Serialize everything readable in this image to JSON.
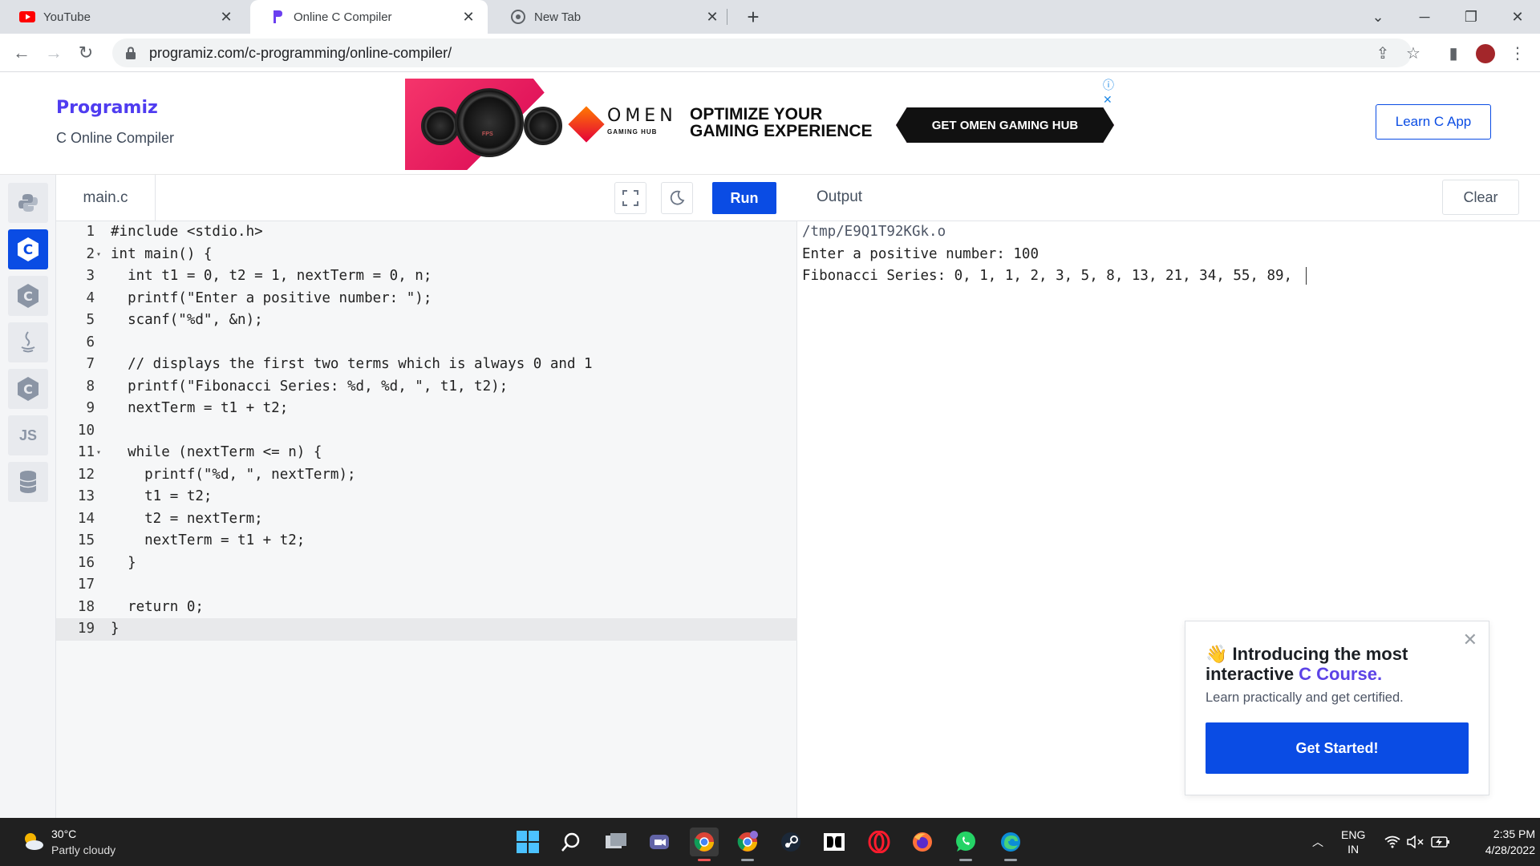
{
  "browser": {
    "tabs": [
      {
        "title": "YouTube",
        "icon": "youtube-icon"
      },
      {
        "title": "Online C Compiler",
        "icon": "programiz-icon"
      },
      {
        "title": "New Tab",
        "icon": "chrome-icon"
      }
    ],
    "active_tab": 1,
    "url": "programiz.com/c-programming/online-compiler/"
  },
  "header": {
    "logo": "Programiz",
    "subtitle": "C Online Compiler",
    "learn_button": "Learn C App",
    "ad": {
      "brand": "OMEN",
      "brand_sub": "GAMING HUB",
      "headline_line1": "OPTIMIZE YOUR",
      "headline_line2": "GAMING EXPERIENCE",
      "cta": "GET OMEN GAMING HUB",
      "gauge_label": "FPS"
    }
  },
  "sidebar": {
    "languages": [
      {
        "name": "python-icon",
        "glyph": "",
        "active": false
      },
      {
        "name": "c-icon",
        "glyph": "C",
        "active": true
      },
      {
        "name": "cpp-icon",
        "glyph": "C",
        "active": false
      },
      {
        "name": "java-icon",
        "glyph": "",
        "active": false
      },
      {
        "name": "csharp-icon",
        "glyph": "C",
        "active": false
      },
      {
        "name": "javascript-icon",
        "glyph": "JS",
        "active": false
      },
      {
        "name": "sql-icon",
        "glyph": "",
        "active": false
      }
    ]
  },
  "editor": {
    "filename": "main.c",
    "run_label": "Run",
    "fold_lines": [
      2,
      11
    ],
    "highlight_line": 19,
    "lines": [
      "#include <stdio.h>",
      "int main() {",
      "  int t1 = 0, t2 = 1, nextTerm = 0, n;",
      "  printf(\"Enter a positive number: \");",
      "  scanf(\"%d\", &n);",
      "",
      "  // displays the first two terms which is always 0 and 1",
      "  printf(\"Fibonacci Series: %d, %d, \", t1, t2);",
      "  nextTerm = t1 + t2;",
      "",
      "  while (nextTerm <= n) {",
      "    printf(\"%d, \", nextTerm);",
      "    t1 = t2;",
      "    t2 = nextTerm;",
      "    nextTerm = t1 + t2;",
      "  }",
      "",
      "  return 0;",
      "}"
    ]
  },
  "output": {
    "title": "Output",
    "clear_label": "Clear",
    "lines": [
      "/tmp/E9Q1T92KGk.o",
      "Enter a positive number: 100",
      "Fibonacci Series: 0, 1, 1, 2, 3, 5, 8, 13, 21, 34, 55, 89, "
    ]
  },
  "promo": {
    "emoji": "👋",
    "title_part1": "Introducing the most interactive ",
    "title_highlight": "C Course.",
    "subtitle": "Learn practically and get certified.",
    "button": "Get Started!"
  },
  "taskbar": {
    "weather_temp": "30°C",
    "weather_desc": "Partly cloudy",
    "lang_top": "ENG",
    "lang_bottom": "IN",
    "time": "2:35 PM",
    "date": "4/28/2022"
  },
  "colors": {
    "accent": "#0a4ce4",
    "brand_purple": "#5c43e6"
  }
}
